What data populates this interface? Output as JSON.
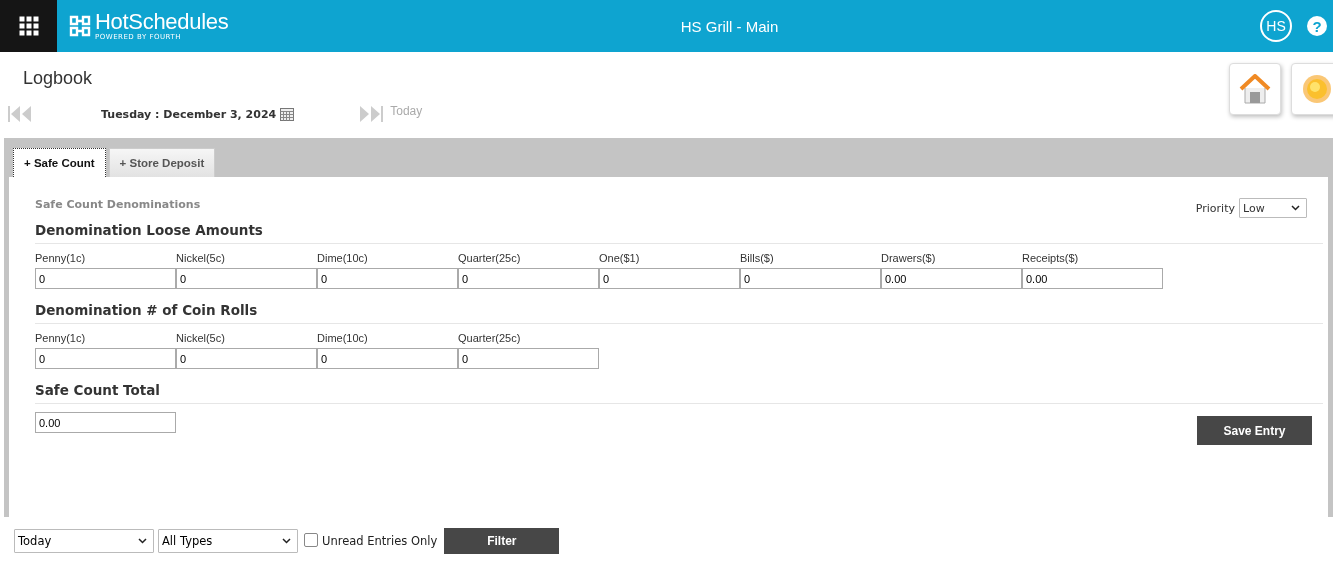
{
  "header": {
    "logo": "HotSchedules",
    "logo_tagline": "POWERED BY FOURTH",
    "title": "HS Grill - Main",
    "avatar": "HS",
    "help": "?"
  },
  "page": {
    "title": "Logbook"
  },
  "date_nav": {
    "date": "Tuesday : December 3, 2024",
    "today": "Today"
  },
  "tabs": [
    {
      "label": "+ Safe Count",
      "selected": true
    },
    {
      "label": "+ Store Deposit",
      "selected": false
    }
  ],
  "form": {
    "title": "Safe Count Denominations",
    "priority": {
      "label": "Priority",
      "value": "Low"
    },
    "sections": [
      {
        "heading": "Denomination Loose Amounts",
        "fields": [
          {
            "label": "Penny(1c)",
            "value": "0"
          },
          {
            "label": "Nickel(5c)",
            "value": "0"
          },
          {
            "label": "Dime(10c)",
            "value": "0"
          },
          {
            "label": "Quarter(25c)",
            "value": "0"
          },
          {
            "label": "One($1)",
            "value": "0"
          },
          {
            "label": "Bills($)",
            "value": "0"
          },
          {
            "label": "Drawers($)",
            "value": "0.00"
          },
          {
            "label": "Receipts($)",
            "value": "0.00"
          }
        ]
      },
      {
        "heading": "Denomination # of Coin Rolls",
        "fields": [
          {
            "label": "Penny(1c)",
            "value": "0"
          },
          {
            "label": "Nickel(5c)",
            "value": "0"
          },
          {
            "label": "Dime(10c)",
            "value": "0"
          },
          {
            "label": "Quarter(25c)",
            "value": "0"
          }
        ]
      },
      {
        "heading": "Safe Count Total",
        "fields": [
          {
            "value": "0.00"
          }
        ]
      }
    ],
    "save_button": "Save Entry"
  },
  "filter_bar": {
    "date_range": "Today",
    "type": "All Types",
    "unread_only": {
      "label": "Unread Entries Only",
      "checked": false
    },
    "button": "Filter"
  }
}
